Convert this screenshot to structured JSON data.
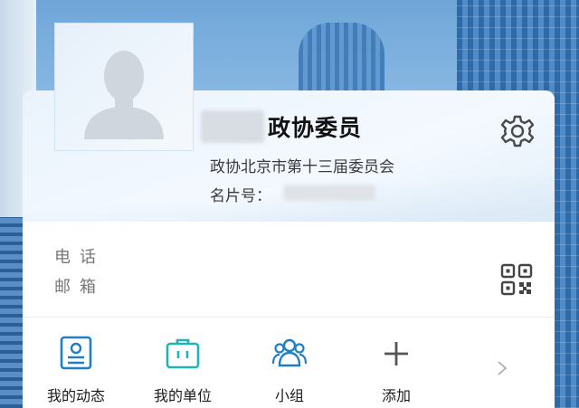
{
  "profile": {
    "title": "政协委员",
    "organization": "政协北京市第十三届委员会",
    "card_number_label": "名片号：",
    "settings_icon": "gear-icon",
    "avatar_icon": "person-silhouette-icon"
  },
  "contact": {
    "phone_label": "电话",
    "email_label": "邮箱",
    "qr_icon": "qr-code-icon"
  },
  "nav": {
    "items": [
      {
        "label": "我的动态",
        "icon": "profile-card-icon"
      },
      {
        "label": "我的单位",
        "icon": "briefcase-icon"
      },
      {
        "label": "小组",
        "icon": "group-icon"
      },
      {
        "label": "添加",
        "icon": "plus-icon"
      }
    ],
    "more_icon": "chevron-right-icon"
  },
  "colors": {
    "icon_blue": "#1f7fc6",
    "icon_teal": "#1fb5b8",
    "text_dark": "#111111",
    "text_gray": "#777777"
  }
}
